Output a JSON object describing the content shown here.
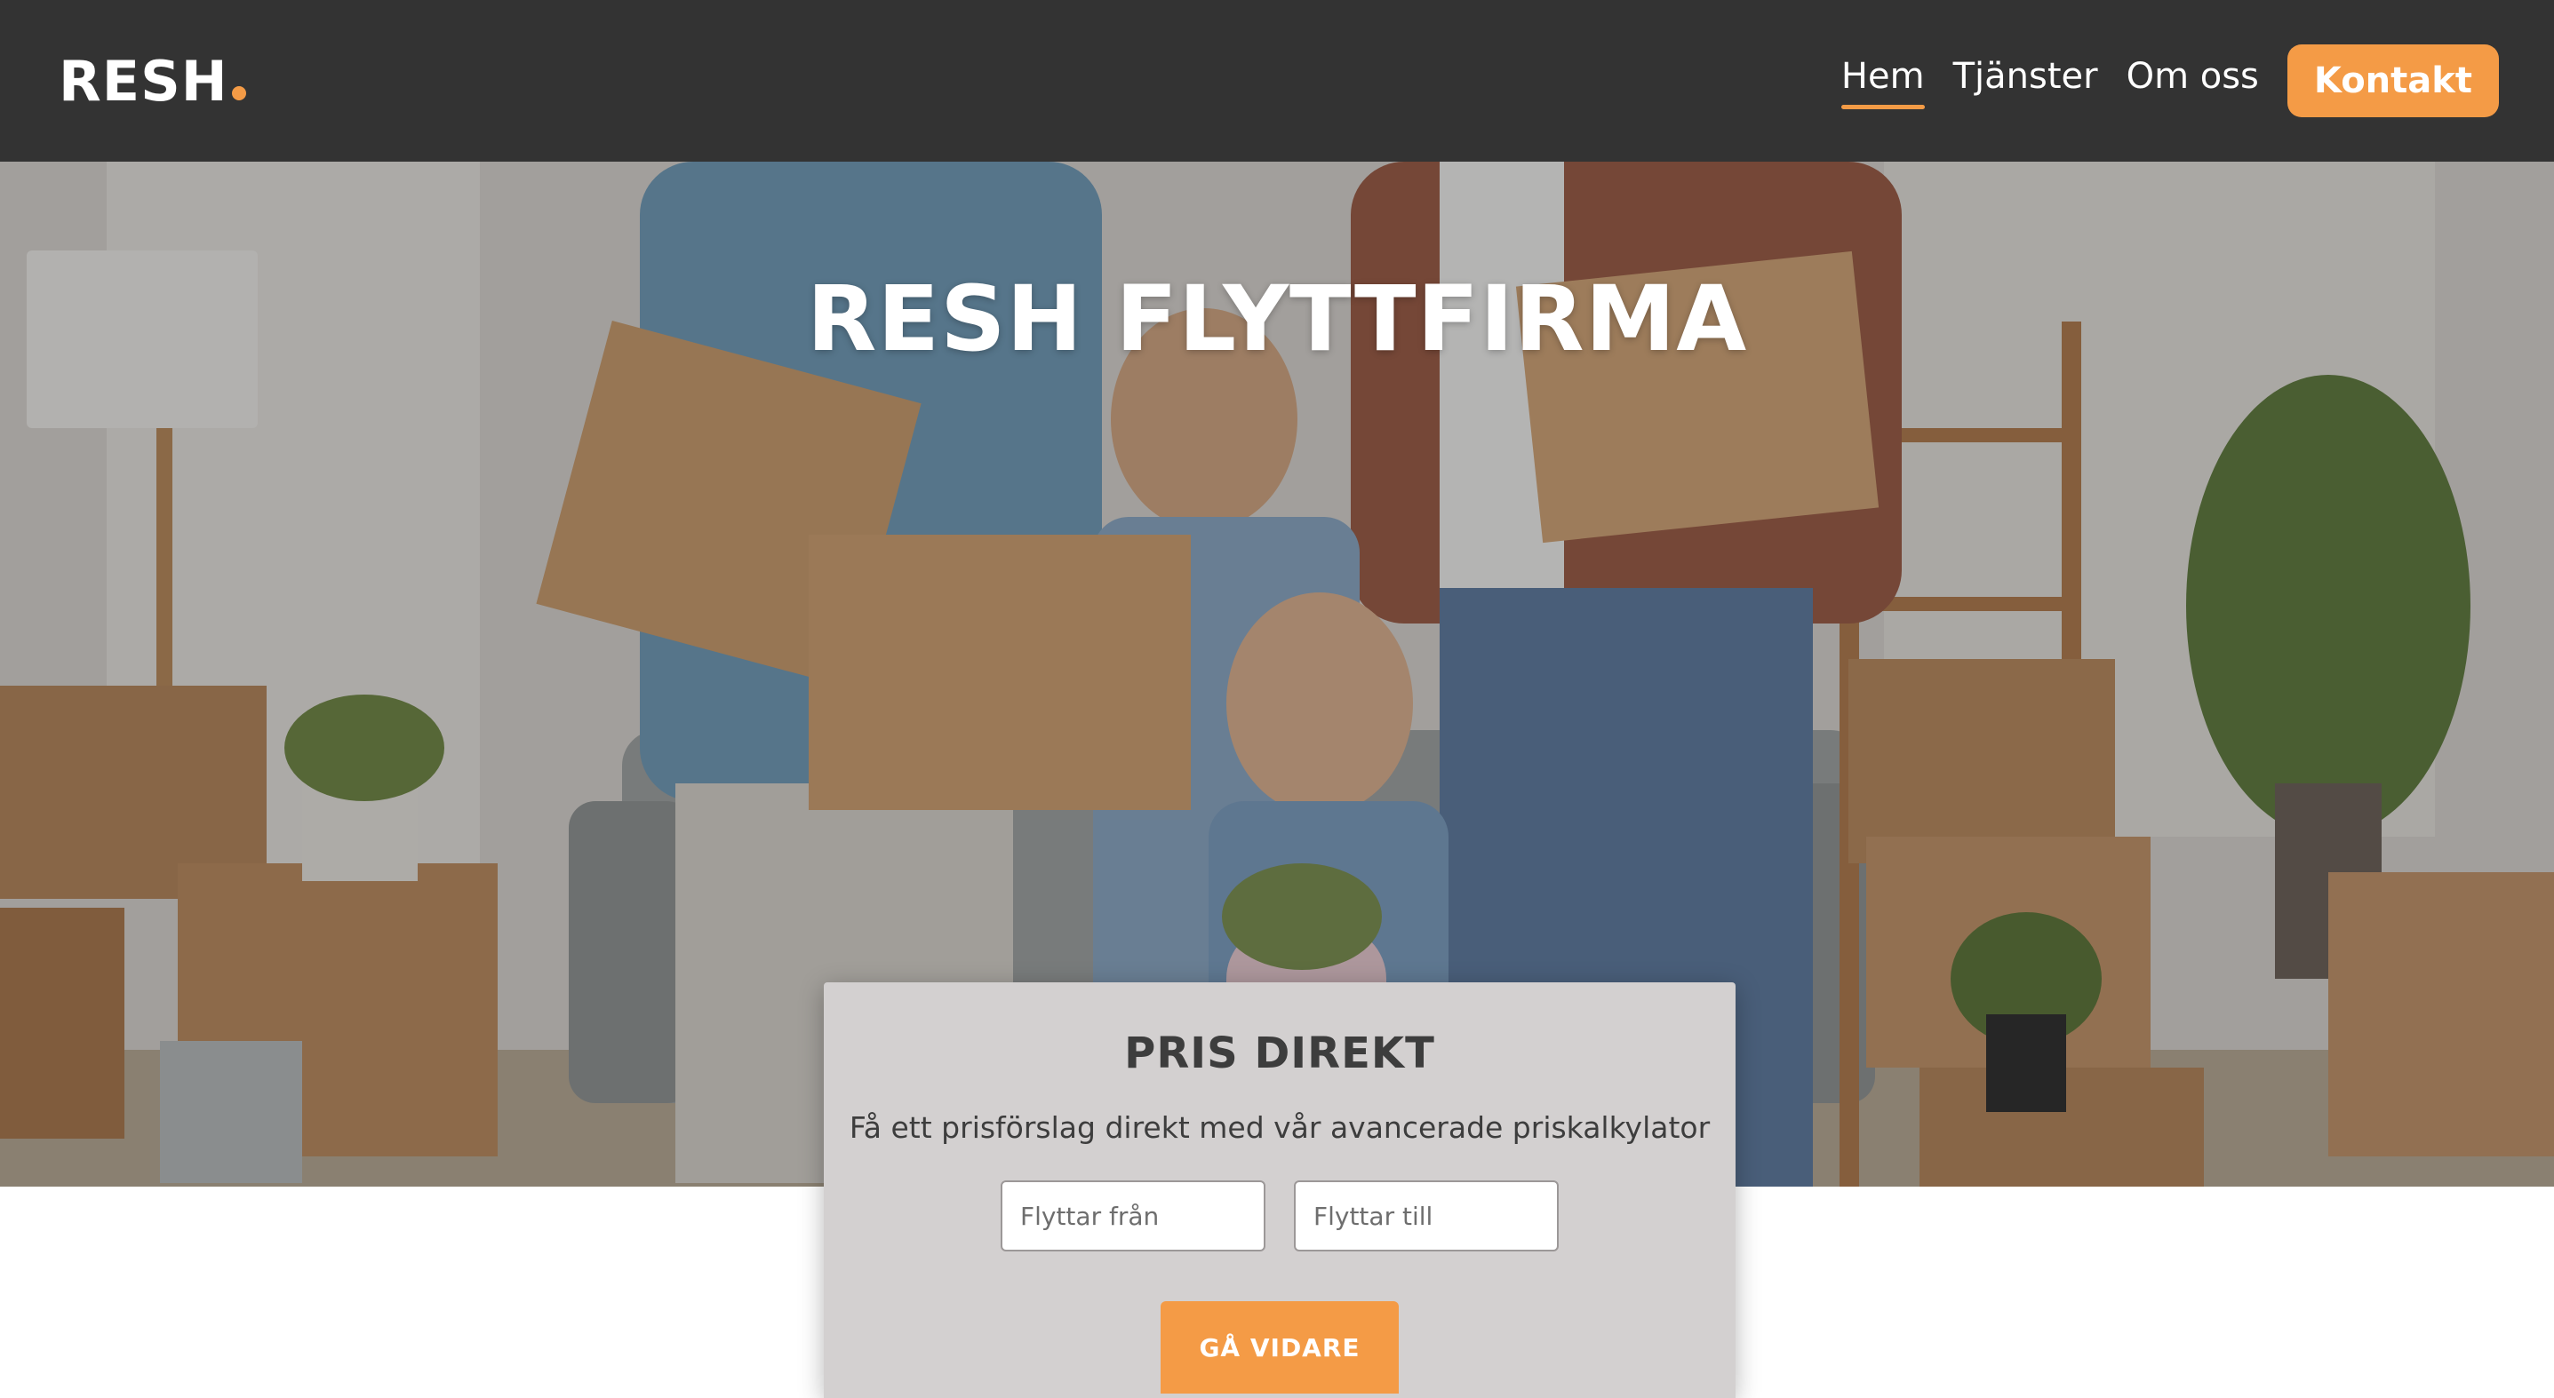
{
  "colors": {
    "accent": "#f49b46",
    "header_bg": "#333333",
    "card_bg": "#d3d0d0"
  },
  "header": {
    "logo_text": "RESH",
    "nav": [
      {
        "label": "Hem",
        "active": true
      },
      {
        "label": "Tjänster",
        "active": false
      },
      {
        "label": "Om oss",
        "active": false
      }
    ],
    "cta_label": "Kontakt"
  },
  "hero": {
    "title": "RESH FLYTTFIRMA"
  },
  "quote": {
    "title": "PRIS DIREKT",
    "subtitle": "Få ett prisförslag direkt med vår avancerade priskalkylator",
    "from_placeholder": "Flyttar från",
    "to_placeholder": "Flyttar till",
    "button_label": "GÅ VIDARE"
  }
}
